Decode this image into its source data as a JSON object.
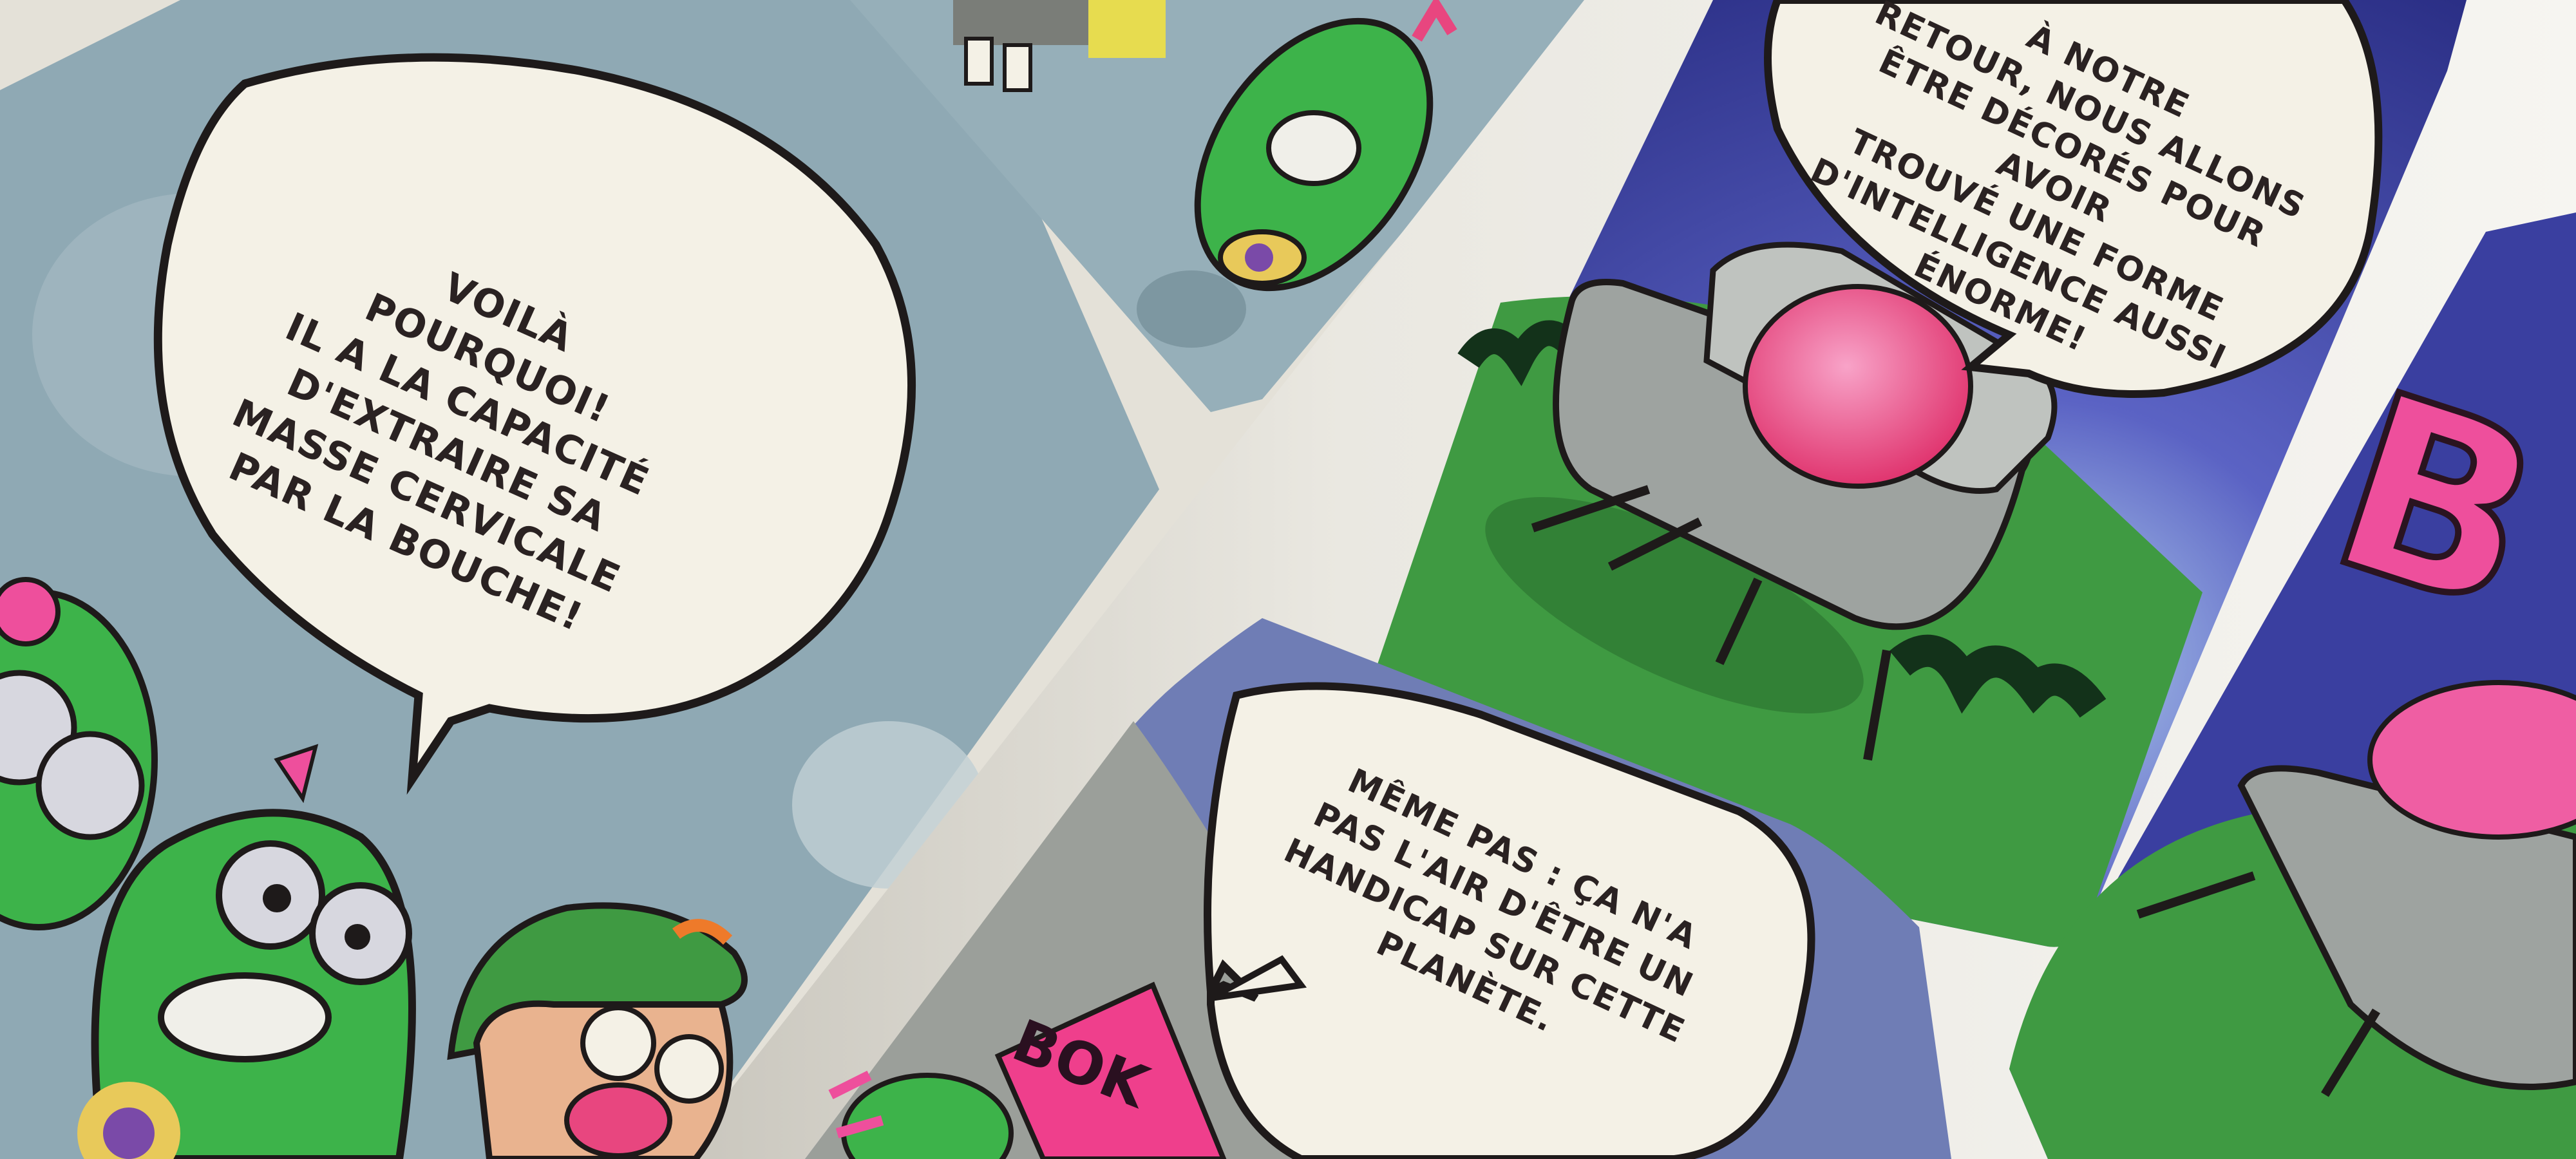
{
  "bubbles": {
    "left_panel": "VOILÀ\nPOURQUOI!\nIL A LA CAPACITÉ\nD'EXTRAIRE SA\nMASSE CERVICALE\nPAR LA BOUCHE!",
    "top_right": "À NOTRE\nRETOUR, NOUS ALLONS\nÊTRE DÉCORÉS POUR AVOIR\nTROUVÉ UNE FORME\nD'INTELLIGENCE AUSSI\nÉNORME!",
    "bottom_middle": "MÊME PAS : ÇA N'A\nPAS L'AIR D'ÊTRE UN\nHANDICAP SUR CETTE\nPLANÈTE."
  },
  "sound_effects": {
    "bok": "BOK",
    "partial_b": "B"
  },
  "colors": {
    "left_panel_bg": "#8fa9b4",
    "night_sky": "#2e3a8c",
    "grass": "#3f9a42",
    "ufo_dome": "#e8467f",
    "ufo_hull": "#9ea3a0",
    "alien_green": "#3db34a",
    "bubble_fill": "#f4f1e6",
    "ink": "#2a2222"
  }
}
